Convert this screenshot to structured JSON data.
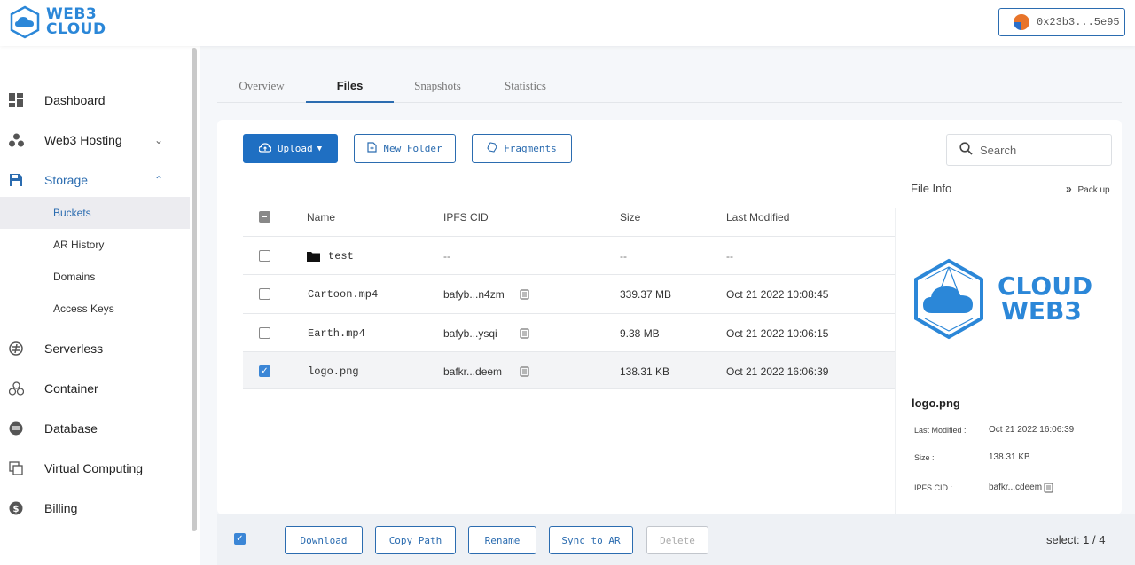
{
  "brand": {
    "line1": "WEB3",
    "line2": "CLOUD"
  },
  "wallet": {
    "address": "0x23b3...5e95"
  },
  "sidebar": {
    "items": [
      {
        "label": "Dashboard",
        "icon": "dashboard-icon"
      },
      {
        "label": "Web3 Hosting",
        "icon": "hosting-icon"
      },
      {
        "label": "Storage",
        "icon": "storage-icon"
      },
      {
        "label": "Serverless",
        "icon": "serverless-icon"
      },
      {
        "label": "Container",
        "icon": "container-icon"
      },
      {
        "label": "Database",
        "icon": "database-icon"
      },
      {
        "label": "Virtual Computing",
        "icon": "virtual-computing-icon"
      },
      {
        "label": "Billing",
        "icon": "billing-icon"
      }
    ],
    "storage_sub": [
      {
        "label": "Buckets"
      },
      {
        "label": "AR History"
      },
      {
        "label": "Domains"
      },
      {
        "label": "Access Keys"
      }
    ]
  },
  "tabs": [
    {
      "label": "Overview"
    },
    {
      "label": "Files"
    },
    {
      "label": "Snapshots"
    },
    {
      "label": "Statistics"
    }
  ],
  "toolbar": {
    "upload": "Upload",
    "new_folder": "New Folder",
    "fragments": "Fragments",
    "search_placeholder": "Search"
  },
  "table": {
    "headers": {
      "name": "Name",
      "cid": "IPFS CID",
      "size": "Size",
      "modified": "Last Modified"
    },
    "rows": [
      {
        "name": "test",
        "cid": "--",
        "size": "--",
        "modified": "--",
        "type": "folder",
        "checked": false
      },
      {
        "name": "Cartoon.mp4",
        "cid": "bafyb...n4zm",
        "size": "339.37 MB",
        "modified": "Oct 21 2022 10:08:45",
        "type": "file",
        "checked": false
      },
      {
        "name": "Earth.mp4",
        "cid": "bafyb...ysqi",
        "size": "9.38 MB",
        "modified": "Oct 21 2022 10:06:15",
        "type": "file",
        "checked": false
      },
      {
        "name": "logo.png",
        "cid": "bafkr...deem",
        "size": "138.31 KB",
        "modified": "Oct 21 2022 16:06:39",
        "type": "file",
        "checked": true
      }
    ]
  },
  "file_info": {
    "title": "File Info",
    "pack_up": "Pack up",
    "logo_line1": "CLOUD",
    "logo_line2": "WEB3",
    "name": "logo.png",
    "last_modified_label": "Last Modified :",
    "last_modified": "Oct 21 2022 16:06:39",
    "size_label": "Size :",
    "size": "138.31 KB",
    "cid_label": "IPFS CID :",
    "cid": "bafkr...cdeem"
  },
  "bottom": {
    "download": "Download",
    "copy_path": "Copy Path",
    "rename": "Rename",
    "sync_ar": "Sync to AR",
    "delete": "Delete",
    "select_count": "select: 1 / 4"
  },
  "colors": {
    "accent": "#2b6cb0",
    "brand": "#2b87d8",
    "primary_button": "#1f6fc2"
  }
}
